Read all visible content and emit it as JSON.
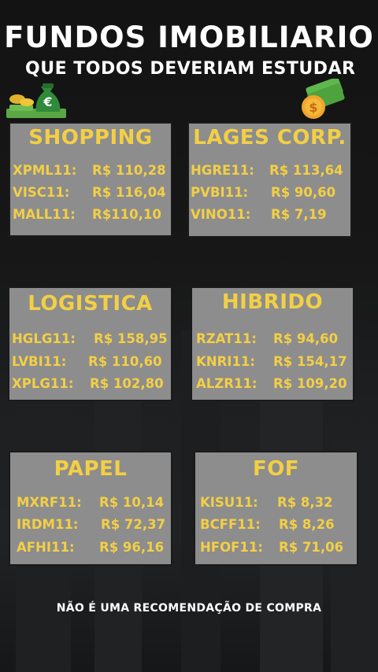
{
  "header": {
    "title": "FUNDOS IMOBILIARIO",
    "subtitle": "QUE TODOS DEVERIAM ESTUDAR"
  },
  "decor": {
    "left_icon": "money-bag-euro-icon",
    "left_glyph": "€",
    "right_icon": "money-dollar-icon",
    "right_glyph": "$"
  },
  "colors": {
    "accent": "#f3cf45",
    "card_bg": "#8d8d8d",
    "text": "#ffffff"
  },
  "cards": [
    {
      "title": "SHOPPING",
      "rows": [
        {
          "ticker": "XPML11:",
          "price": "R$ 110,28"
        },
        {
          "ticker": "VISC11:",
          "price": "R$ 116,04"
        },
        {
          "ticker": "MALL11:",
          "price": "R$110,10"
        }
      ]
    },
    {
      "title": "LAGES CORP.",
      "rows": [
        {
          "ticker": "HGRE11:",
          "price": "R$ 113,64"
        },
        {
          "ticker": "PVBI11:",
          "price": "R$ 90,60"
        },
        {
          "ticker": "VINO11:",
          "price": "R$ 7,19"
        }
      ]
    },
    {
      "title": "LOGISTICA",
      "rows": [
        {
          "ticker": "HGLG11:",
          "price": "R$ 158,95"
        },
        {
          "ticker": "LVBI11:",
          "price": "R$ 110,60"
        },
        {
          "ticker": "XPLG11:",
          "price": "R$ 102,80"
        }
      ]
    },
    {
      "title": "HIBRIDO",
      "rows": [
        {
          "ticker": "RZAT11:",
          "price": "R$ 94,60"
        },
        {
          "ticker": "KNRI11:",
          "price": "R$ 154,17"
        },
        {
          "ticker": "ALZR11:",
          "price": "R$ 109,20"
        }
      ]
    },
    {
      "title": "PAPEL",
      "rows": [
        {
          "ticker": "MXRF11:",
          "price": "R$ 10,14"
        },
        {
          "ticker": "IRDM11:",
          "price": "R$ 72,37"
        },
        {
          "ticker": "AFHI11:",
          "price": "R$ 96,16"
        }
      ]
    },
    {
      "title": "FOF",
      "rows": [
        {
          "ticker": "KISU11:",
          "price": "R$ 8,32"
        },
        {
          "ticker": "BCFF11:",
          "price": "R$ 8,26"
        },
        {
          "ticker": "HFOF11:",
          "price": "R$ 71,06"
        }
      ]
    }
  ],
  "footer": {
    "disclaimer": "NÃO É UMA RECOMENDAÇÃO DE COMPRA"
  }
}
